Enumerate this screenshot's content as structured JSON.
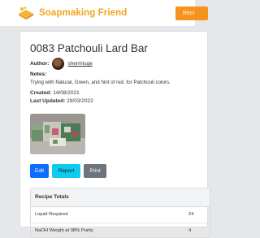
{
  "header": {
    "brand": "Soapmaking Friend",
    "nav_button": "Reci"
  },
  "recipe": {
    "title": "0083 Patchouli Lard Bar",
    "author_label": "Author:",
    "author_name": "shermluge",
    "notes_label": "Notes:",
    "notes": "Trying with Natural, Green, and hint of red. for Patchouli colors.",
    "created_label": "Created:",
    "created": "14/08/2021",
    "updated_label": "Last Updated:",
    "updated": "29/03/2022"
  },
  "actions": {
    "edit": "Edit",
    "report": "Report",
    "print": "Print"
  },
  "totals": {
    "heading": "Recipe Totals",
    "rows": [
      {
        "label": "Liquid Required",
        "value": "24"
      },
      {
        "label": "NaOH Weight at 98% Purity",
        "value": "4"
      }
    ]
  },
  "colors": {
    "brand_orange": "#f4a31f",
    "nav_orange": "#f6921e",
    "edit_blue": "#0d6efd",
    "report_cyan": "#0dcaf0",
    "print_gray": "#6c757d"
  }
}
